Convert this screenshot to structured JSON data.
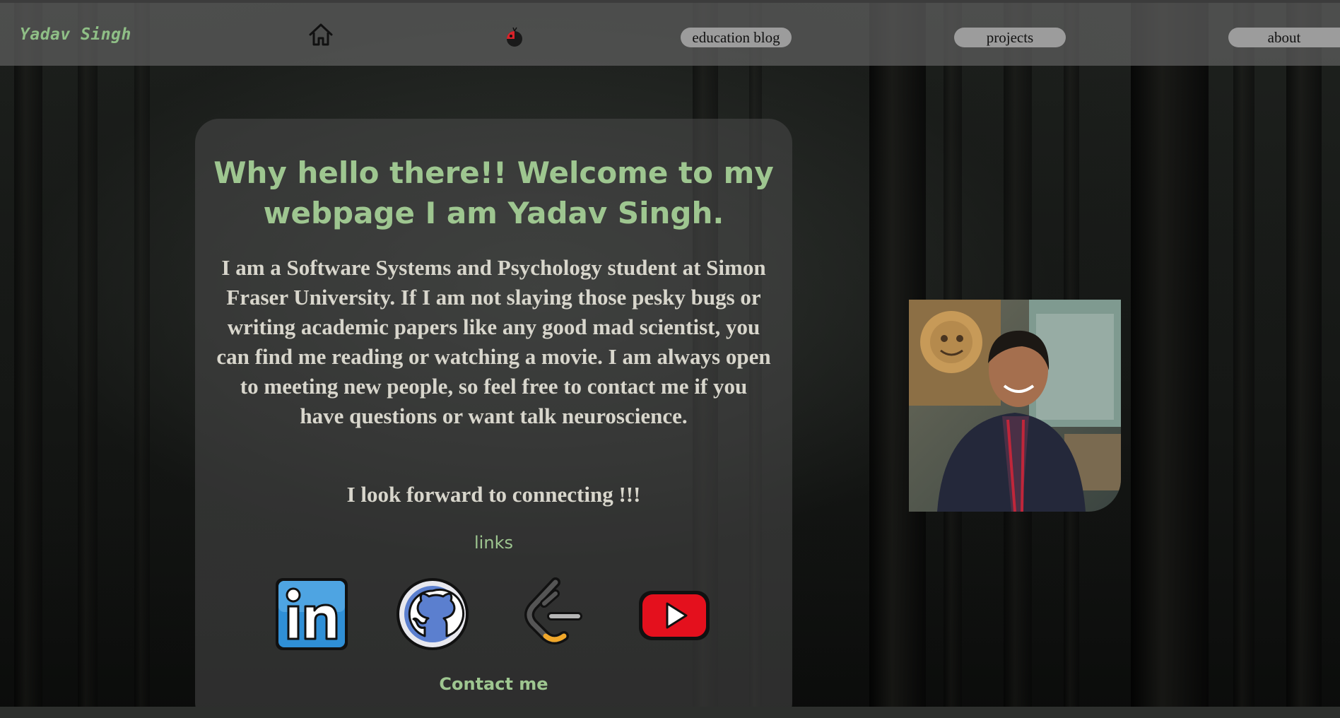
{
  "navbar": {
    "brand": "Yadav Singh",
    "home_icon": "home-icon",
    "bug_icon": "ladybug-icon",
    "links": {
      "education": "education blog",
      "projects": "projects",
      "about": "about"
    }
  },
  "intro": {
    "headline": "Why hello there!! Welcome to my webpage I am Yadav Singh.",
    "bio": "I am a Software Systems and Psychology student at Simon Fraser University. If I am not slaying those pesky bugs or writing academic papers like any good mad scientist, you can find me reading or watching a movie. I am always open to meeting new people, so feel free to contact me if you have questions or want talk neuroscience.",
    "closing": "I look forward to connecting !!!",
    "links_label": "links",
    "contact_label": "Contact me"
  },
  "social": [
    {
      "name": "linkedin",
      "icon": "linkedin-icon"
    },
    {
      "name": "github",
      "icon": "github-icon"
    },
    {
      "name": "leetcode",
      "icon": "leetcode-icon"
    },
    {
      "name": "youtube",
      "icon": "youtube-icon"
    }
  ],
  "photo": {
    "alt": "portrait photo"
  },
  "colors": {
    "accent": "#9ec690",
    "text": "#d8d6cc",
    "nav_bg": "#5f5f5f",
    "pill_bg": "#9c9c9c"
  }
}
